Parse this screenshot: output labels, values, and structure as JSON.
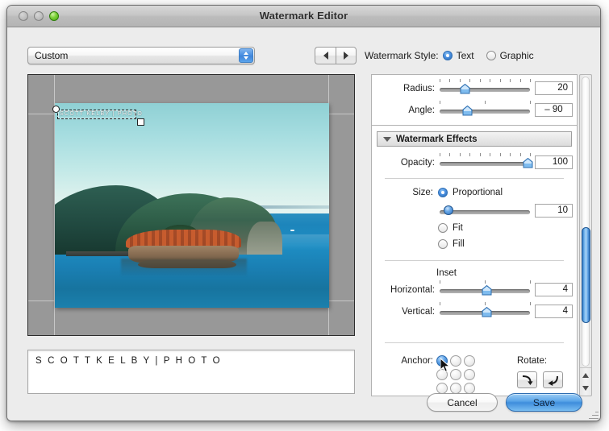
{
  "window": {
    "title": "Watermark Editor",
    "traffic_lights": [
      "close-dim",
      "minimize-dim",
      "zoom-green"
    ]
  },
  "left": {
    "preset": {
      "value": "Custom",
      "icon": "updown-stepper-icon"
    },
    "nav": {
      "prev_icon": "left-arrow-icon",
      "next_icon": "right-arrow-icon"
    },
    "watermark_text": "S C O T T  K E L B Y | P H O T O",
    "overlay_text": "SCOTT KELBY | PHOTO"
  },
  "style": {
    "label": "Watermark Style:",
    "options": [
      {
        "label": "Text",
        "selected": true
      },
      {
        "label": "Graphic",
        "selected": false
      }
    ]
  },
  "panel": {
    "shadow": {
      "radius": {
        "label": "Radius:",
        "value": "20",
        "pct": 28,
        "ticks": 10
      },
      "angle": {
        "label": "Angle:",
        "value": "– 90",
        "pct": 30,
        "ticks": 3
      }
    },
    "effects": {
      "header": "Watermark Effects",
      "opacity": {
        "label": "Opacity:",
        "value": "100",
        "pct": 97,
        "ticks": 10
      },
      "size": {
        "label": "Size:",
        "options": [
          {
            "label": "Proportional",
            "selected": true
          },
          {
            "label": "Fit",
            "selected": false
          },
          {
            "label": "Fill",
            "selected": false
          }
        ],
        "value": "10",
        "pct": 10
      },
      "inset": {
        "header": "Inset",
        "horizontal": {
          "label": "Horizontal:",
          "value": "4",
          "pct": 52,
          "ticks": 3
        },
        "vertical": {
          "label": "Vertical:",
          "value": "4",
          "pct": 52,
          "ticks": 3
        }
      },
      "anchor": {
        "label": "Anchor:",
        "selected_index": 0,
        "cells": 9
      },
      "rotate": {
        "label": "Rotate:",
        "buttons": [
          "rotate-clockwise-icon",
          "rotate-counterclockwise-icon"
        ]
      }
    }
  },
  "scrollbar": {
    "orientation": "vertical",
    "thumb_top_pct": 52,
    "thumb_height_pct": 33
  },
  "footer": {
    "cancel_label": "Cancel",
    "save_label": "Save"
  },
  "colors": {
    "accent": "#4a90e2",
    "window_bg": "#ececec",
    "stage_bg": "#989898",
    "save_blue": "#3e8ddc"
  }
}
